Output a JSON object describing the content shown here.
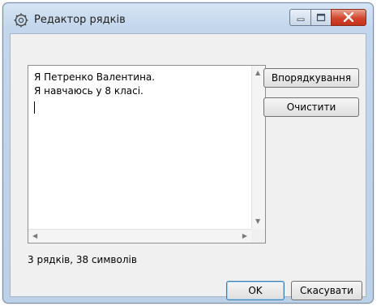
{
  "window": {
    "title": "Редактор рядків",
    "icon": "app-editor-icon",
    "controls": {
      "minimize": "minimize-icon",
      "maximize": "maximize-icon",
      "close": "close-icon"
    }
  },
  "editor": {
    "lines": [
      "Я Петренко Валентина.",
      "Я навчаюсь у 8 класі.",
      ""
    ],
    "text": "Я Петренко Валентина.\nЯ навчаюсь у 8 класі.\n"
  },
  "buttons": {
    "sort_label": "Впорядкування",
    "clear_label": "Очистити",
    "ok_label": "OK",
    "cancel_label": "Скасувати"
  },
  "status": {
    "text": "3 рядків, 38 символів"
  },
  "colors": {
    "frame": "#c3d6ec",
    "client": "#f0f0f0",
    "close_button": "#d2452c",
    "default_button_border": "#3c7fb1"
  }
}
